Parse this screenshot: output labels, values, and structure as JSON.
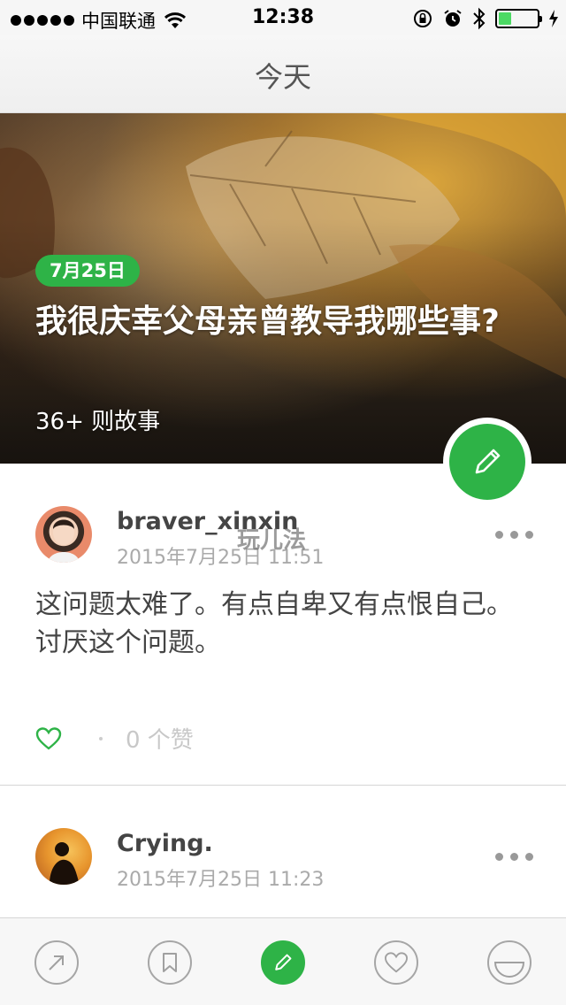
{
  "status_bar": {
    "carrier": "中国联通",
    "time": "12:38"
  },
  "nav": {
    "title": "今天"
  },
  "hero": {
    "date": "7月25日",
    "title": "我很庆幸父母亲曾教导我哪些事?",
    "story_count": "36+ 则故事"
  },
  "watermark": "玩儿法",
  "posts": [
    {
      "username": "braver_xinxin",
      "time": "2015年7月25日 11:51",
      "body": "这问题太难了。有点自卑又有点恨自己。\n讨厌这个问题。",
      "likes": "0 个赞"
    },
    {
      "username": "Crying.",
      "time": "2015年7月25日 11:23"
    }
  ],
  "tabbar": {
    "items": [
      "share-icon",
      "bookmark-icon",
      "compose-icon",
      "heart-icon",
      "smile-icon"
    ],
    "active_color": "#2eb347"
  },
  "colors": {
    "accent": "#2eb347"
  }
}
